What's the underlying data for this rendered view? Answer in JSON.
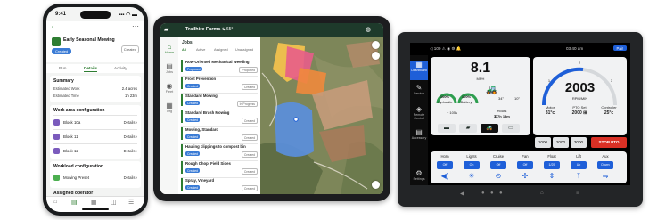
{
  "phone": {
    "time": "9:41",
    "signal": "▪▪▪ ◠ ▬",
    "back": "‹",
    "more": "⋯",
    "title": "Early Seasonal Mowing",
    "badge": "Created",
    "chip": "Created",
    "tabs": [
      "Run",
      "Details",
      "Activity"
    ],
    "summary": {
      "heading": "Summary",
      "rows": [
        {
          "label": "Estimated Work",
          "value": "2.4 acres"
        },
        {
          "label": "Estimated Time",
          "value": "1h 23m"
        }
      ]
    },
    "work_area": {
      "heading": "Work area configuration",
      "blocks": [
        {
          "name": "Block 10a",
          "detail": "Details ›"
        },
        {
          "name": "Block 11",
          "detail": "Details ›"
        },
        {
          "name": "Block 12",
          "detail": "Details ›"
        }
      ]
    },
    "workload": {
      "heading": "Workload configuration",
      "item": {
        "name": "Mowing Preset",
        "detail": "Details ›"
      }
    },
    "assigned": "Assigned operator",
    "nav_icons": [
      "⌂",
      "▤",
      "▦",
      "◫",
      "☰"
    ]
  },
  "tablet": {
    "farm_name": "Trailhire Farms ⌄",
    "temperature": "☀ 65°",
    "rail": [
      {
        "icon": "⌂",
        "label": "Home"
      },
      {
        "icon": "▤",
        "label": "Jobs"
      },
      {
        "icon": "◉",
        "label": "Fleet"
      },
      {
        "icon": "▦",
        "label": "Org"
      }
    ],
    "list_title": "Jobs",
    "tabs": [
      "All",
      "Active",
      "Assigned",
      "Unassigned"
    ],
    "jobs": [
      {
        "name": "Row-Oriented Mechanical Weeding",
        "tag": "Proposed",
        "status": "Proposed"
      },
      {
        "name": "Frost Prevention",
        "tag": "Created",
        "status": "Created"
      },
      {
        "name": "Standard Mowing",
        "tag": "Created",
        "status": "In Progress"
      },
      {
        "name": "Standard Brush Mowing",
        "tag": "Created",
        "status": "Created"
      },
      {
        "name": "Mowing, Standard",
        "tag": "Created",
        "status": "Created"
      },
      {
        "name": "Hauling clippings to compost bin",
        "tag": "Created",
        "status": "Created"
      },
      {
        "name": "Rough Chop, Field Sides",
        "tag": "Created",
        "status": "Created"
      },
      {
        "name": "Spray, Vineyard",
        "tag": "Created",
        "status": "Created"
      }
    ]
  },
  "display": {
    "top_left": "◁ 100  ⚠ ◉ ⚙ 🔔",
    "clock": "03:40 am",
    "top_button": "Pair",
    "side": [
      {
        "icon": "▦",
        "label": "Dashboard"
      },
      {
        "icon": "✎",
        "label": "Service"
      },
      {
        "icon": "◈",
        "label": "Remote Control"
      },
      {
        "icon": "▤",
        "label": "Accessory"
      }
    ],
    "speed": "8.1",
    "speed_unit": "MPH",
    "gauges": [
      {
        "value": "100%",
        "label": "Hydraulic"
      },
      {
        "value": "100%",
        "label": "Battery"
      }
    ],
    "tilt": "34°",
    "pitch": "10°",
    "odometer": "+ 105s",
    "hours_label": "Hours",
    "hours": "⧖ 7h 13m",
    "rpm": "2003",
    "rpm_unit": "RPM/MIN",
    "rpm_scale": [
      "1",
      "2",
      "3"
    ],
    "temps": [
      {
        "label": "Motor",
        "value": "31°c"
      },
      {
        "label": "PTO Set",
        "value": "2000 ⊞"
      },
      {
        "label": "Controller",
        "value": "25°c"
      }
    ],
    "pto_buttons": [
      "1000",
      "2000",
      "3000"
    ],
    "stop": "STOP PTO",
    "bottom": [
      {
        "heading": "Horn",
        "icon": "◀)"
      },
      {
        "heading": "Lights",
        "icon": "☀"
      },
      {
        "heading": "Cruise",
        "icon": "⊙"
      },
      {
        "heading": "Fan",
        "icon": "✣"
      },
      {
        "heading": "Float",
        "icon": "⇕"
      },
      {
        "heading": "Lift",
        "icon": "⤒"
      },
      {
        "heading": "Aux",
        "icon": "⇋"
      }
    ],
    "bottom_pills": [
      "Off",
      "On",
      "Off",
      "Off",
      "1/25",
      "Up",
      "Down"
    ],
    "settings": "Settings",
    "hw_buttons": [
      "◀",
      "●",
      "●",
      "●",
      "⌂",
      "≡"
    ]
  }
}
